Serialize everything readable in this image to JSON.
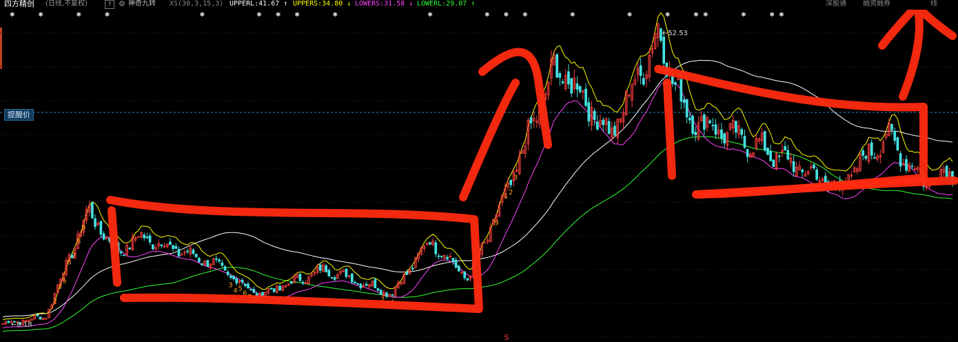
{
  "header": {
    "title": "四方精创",
    "subtitle": "(日线,不复权)",
    "help": "?",
    "indicator": "神奇九转",
    "params": "XS(30,3,15,3)",
    "values": [
      {
        "text": "UPPERL:41.67",
        "arrow": "↑",
        "color": "#ffffff"
      },
      {
        "text": "UPPERS:34.80",
        "arrow": "↓",
        "color": "#ffff00"
      },
      {
        "text": "LOWERS:31.58",
        "arrow": "↓",
        "color": "#ff44ff"
      },
      {
        "text": "LOWERL:29.07",
        "arrow": "↑",
        "color": "#33ff33"
      }
    ],
    "right_tabs": [
      "深股通",
      "融资融券",
      "线"
    ]
  },
  "labels": {
    "alert_price": "提醒价",
    "high_price": "52.53",
    "low_price": "8.18",
    "bottom_marker": "S"
  },
  "colors": {
    "up": "#ff4040",
    "down": "#44e0e0",
    "upperL": "#ffffff",
    "upperS": "#ffff00",
    "lowerS": "#ff44ff",
    "lowerL": "#33ff33",
    "annotation": "#ff2a10",
    "grid": "#3a0f0f",
    "alert_line": "#2a8fd0"
  },
  "chart_data": {
    "type": "candlestick",
    "note_series": "approximate closing-price path read from the chart",
    "key_points": [
      {
        "x": 0,
        "y": 8.18
      },
      {
        "x": 0.045,
        "y": 9.2
      },
      {
        "x": 0.09,
        "y": 25.5
      },
      {
        "x": 0.12,
        "y": 19
      },
      {
        "x": 0.145,
        "y": 21.5
      },
      {
        "x": 0.22,
        "y": 17.5
      },
      {
        "x": 0.27,
        "y": 12.5
      },
      {
        "x": 0.34,
        "y": 16.5
      },
      {
        "x": 0.41,
        "y": 12.8
      },
      {
        "x": 0.45,
        "y": 21
      },
      {
        "x": 0.49,
        "y": 15
      },
      {
        "x": 0.53,
        "y": 28
      },
      {
        "x": 0.58,
        "y": 47
      },
      {
        "x": 0.6,
        "y": 45
      },
      {
        "x": 0.64,
        "y": 37
      },
      {
        "x": 0.69,
        "y": 52.53
      },
      {
        "x": 0.72,
        "y": 40
      },
      {
        "x": 0.8,
        "y": 35
      },
      {
        "x": 0.88,
        "y": 29
      },
      {
        "x": 0.93,
        "y": 37
      },
      {
        "x": 0.97,
        "y": 30
      },
      {
        "x": 1,
        "y": 31.5
      }
    ],
    "y_range": [
      6,
      56
    ],
    "alert_price_level": 40.5,
    "td_counts": [
      "2",
      "3",
      "5",
      "6",
      "7",
      "8",
      "9",
      "3",
      "4",
      "5",
      "6",
      "7",
      "8",
      "9",
      "2",
      "3",
      "4",
      "9",
      "1",
      "2",
      "3"
    ],
    "lines": [
      "UPPERL",
      "UPPERS",
      "LOWERS",
      "LOWERL"
    ],
    "grid": true
  }
}
